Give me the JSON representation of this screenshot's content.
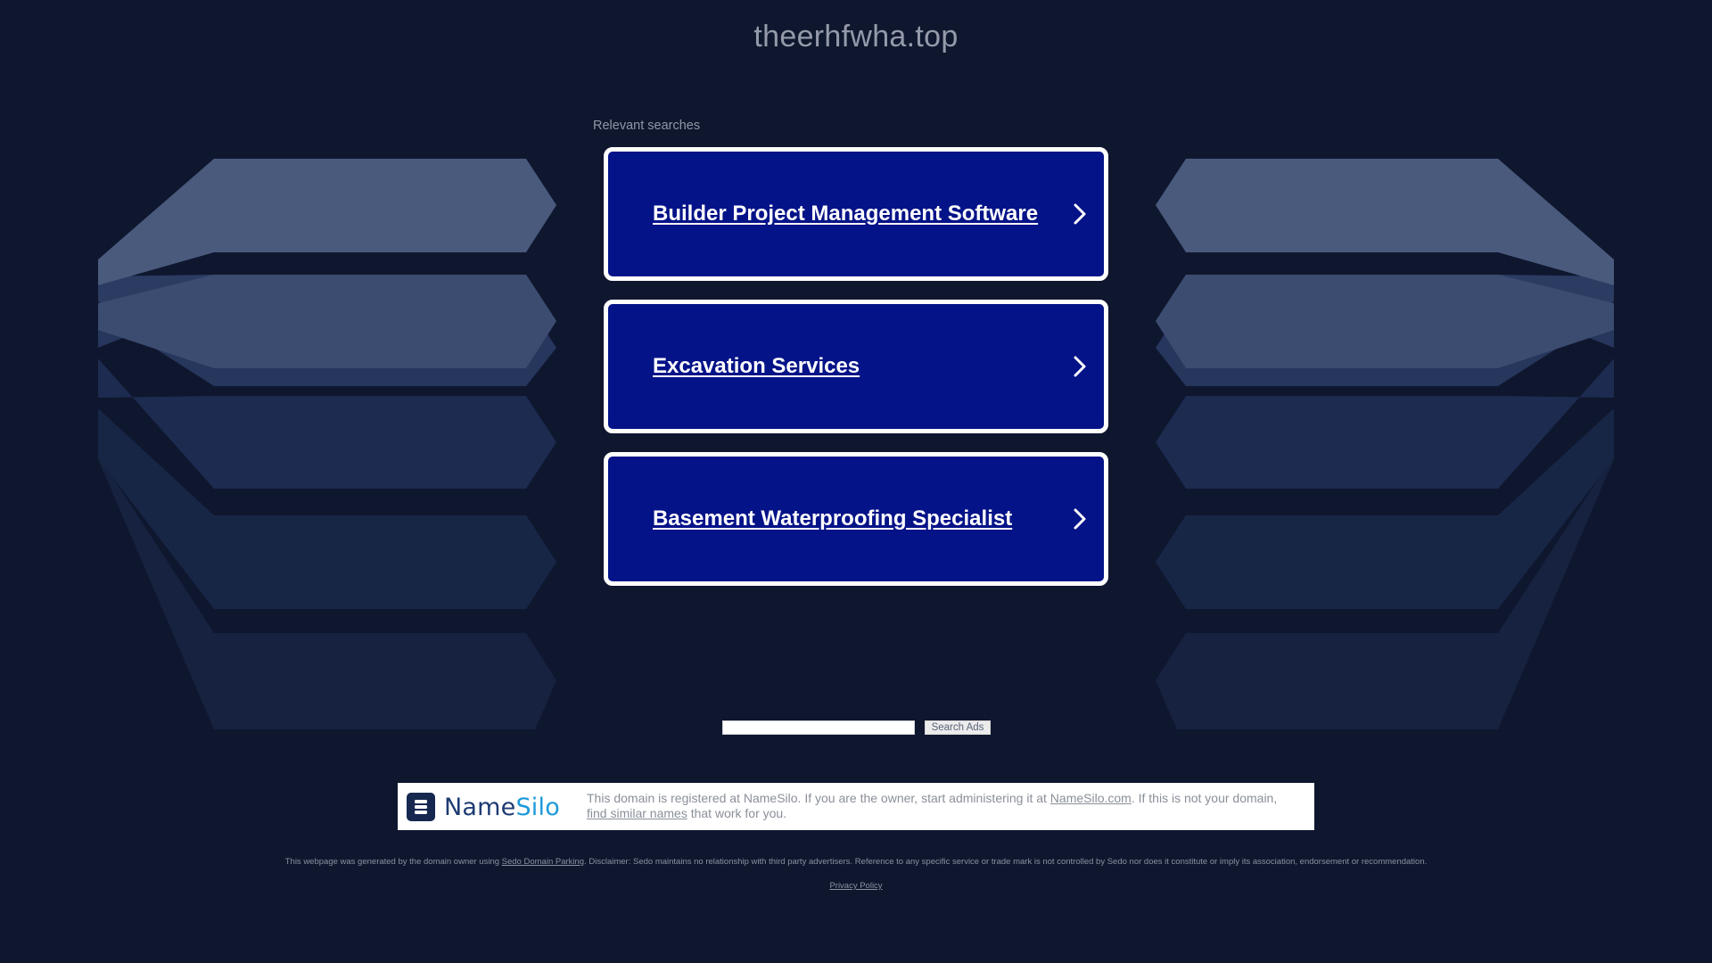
{
  "header": {
    "domain": "theerhfwha.top"
  },
  "related": {
    "label": "Relevant searches",
    "items": [
      {
        "label": "Builder Project Management Software"
      },
      {
        "label": "Excavation Services"
      },
      {
        "label": "Basement Waterproofing Specialist"
      }
    ]
  },
  "search": {
    "input_value": "",
    "button_label": "Search Ads"
  },
  "registrar": {
    "logo_text_part1": "Name",
    "logo_text_part2": "Silo",
    "text_before_link1": "This domain is registered at NameSilo. If you are the owner, start administering it at ",
    "link1": "NameSilo.com",
    "text_after_link1": ". If this is not your domain, ",
    "link2": "find similar names",
    "text_after_link2": " that work for you."
  },
  "footer": {
    "disclaimer_prefix": "This webpage was generated by the domain owner using ",
    "disclaimer_link": "Sedo Domain Parking",
    "disclaimer_suffix": ". Disclaimer: Sedo maintains no relationship with third party advertisers. Reference to any specific service or trade mark is not controlled by Sedo nor does it constitute or imply its association, endorsement or recommendation.",
    "privacy_label": "Privacy Policy"
  },
  "colors": {
    "background": "#0f172f",
    "card_fill": "#051388",
    "card_border": "#ffffff",
    "namesilo_navy": "#1e3b72",
    "namesilo_blue": "#1d9ad9"
  },
  "icons": {
    "card_arrow": "chevron-right-icon",
    "logo_mark": "namesilo-logo-icon"
  }
}
